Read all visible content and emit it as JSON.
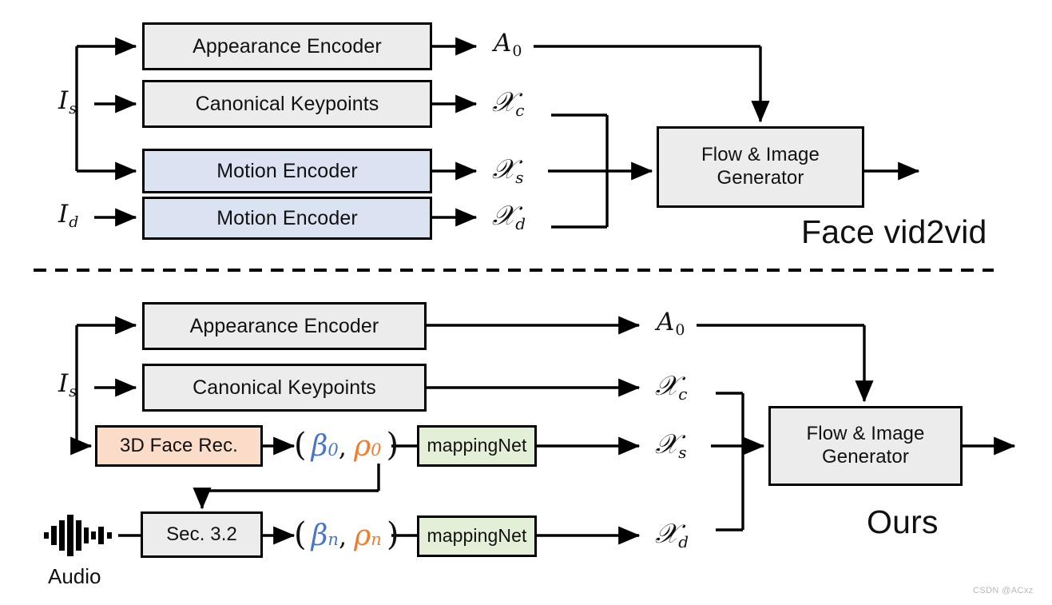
{
  "figure": {
    "type": "architecture-diagram",
    "panels": [
      {
        "id": "top",
        "title": "Face vid2vid",
        "inputs": [
          "I_s",
          "I_d"
        ],
        "blocks": [
          "Appearance Encoder",
          "Canonical  Keypoints",
          "Motion Encoder",
          "Motion Encoder",
          "Flow & Image Generator"
        ],
        "outputs": [
          "A_0",
          "X_c",
          "X_s",
          "X_d"
        ]
      },
      {
        "id": "bottom",
        "title": "Ours",
        "inputs": [
          "I_s",
          "Audio"
        ],
        "blocks": [
          "Appearance Encoder",
          "Canonical  Keypoints",
          "3D Face Rec.",
          "Sec. 3.2",
          "mappingNet",
          "mappingNet",
          "Flow & Image Generator"
        ],
        "outputs": [
          "A_0",
          "X_c",
          "X_s",
          "X_d"
        ]
      }
    ]
  },
  "top": {
    "input_source_label": "I",
    "input_source_sub": "s",
    "input_drive_label": "I",
    "input_drive_sub": "d",
    "block_appearance": "Appearance Encoder",
    "block_keypoints": "Canonical  Keypoints",
    "block_motion_source": "Motion Encoder",
    "block_motion_drive": "Motion Encoder",
    "block_generator_line1": "Flow & Image",
    "block_generator_line2": "Generator",
    "out_appearance": "A",
    "out_appearance_sub": "0",
    "out_canonical": "𝒳",
    "out_canonical_sub": "c",
    "out_source": "𝒳",
    "out_source_sub": "s",
    "out_drive": "𝒳",
    "out_drive_sub": "d",
    "panel_title": "Face vid2vid"
  },
  "bottom": {
    "input_source_label": "I",
    "input_source_sub": "s",
    "block_appearance": "Appearance Encoder",
    "block_keypoints": "Canonical  Keypoints",
    "block_face_rec": "3D Face Rec.",
    "block_sec": "Sec. 3.2",
    "block_mapping_source": "mappingNet",
    "block_mapping_drive": "mappingNet",
    "block_generator_line1": "Flow & Image",
    "block_generator_line2": "Generator",
    "coeffs_source": {
      "open": "(",
      "beta": "β",
      "beta_sub": "0",
      "comma": ",",
      "rho": "ρ",
      "rho_sub": "0",
      "close": ")"
    },
    "coeffs_drive": {
      "open": "(",
      "beta": "β",
      "beta_sub": "n",
      "comma": ",",
      "rho": "ρ",
      "rho_sub": "n",
      "close": ")"
    },
    "out_appearance": "A",
    "out_appearance_sub": "0",
    "out_canonical": "𝒳",
    "out_canonical_sub": "c",
    "out_source": "𝒳",
    "out_source_sub": "s",
    "out_drive": "𝒳",
    "out_drive_sub": "d",
    "audio_caption": "Audio",
    "panel_title": "Ours"
  },
  "watermark": "CSDN @ACxz",
  "colors": {
    "gray_block": "#ececec",
    "blue_block": "#dbe2f1",
    "peach_block": "#fadcc8",
    "green_block": "#e3efd6",
    "beta_blue": "#4a76c8",
    "rho_orange": "#ed7d31",
    "stroke": "#000000",
    "background": "#ffffff",
    "watermark": "#b9b9b9"
  }
}
